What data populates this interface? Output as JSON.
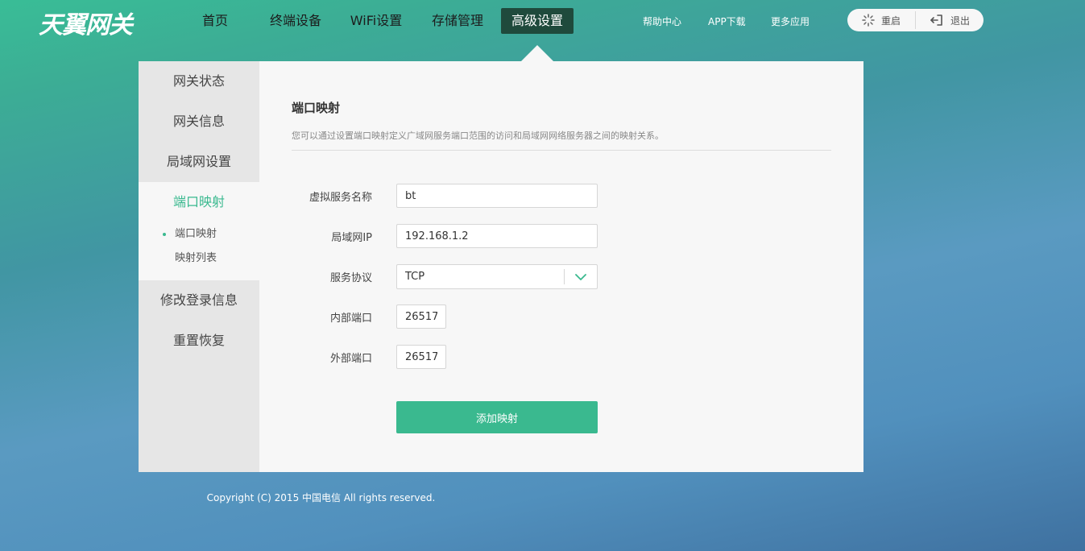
{
  "logo": {
    "text": "天翼网关"
  },
  "nav": {
    "items": [
      "首页",
      "终端设备",
      "WiFi设置",
      "存储管理",
      "高级设置"
    ],
    "active": "高级设置"
  },
  "top_links": [
    "帮助中心",
    "APP下载",
    "更多应用"
  ],
  "actions": {
    "reboot_label": "重启",
    "logout_label": "退出"
  },
  "sidebar": {
    "items": [
      "网关状态",
      "网关信息",
      "局域网设置",
      "端口映射",
      "修改登录信息",
      "重置恢复"
    ],
    "active": "端口映射",
    "subitems": [
      "端口映射",
      "映射列表"
    ],
    "active_sub": "端口映射"
  },
  "page": {
    "title": "端口映射",
    "description": "您可以通过设置端口映射定义广域网服务端口范围的访问和局域网网络服务器之间的映射关系。"
  },
  "form": {
    "service_name_label": "虚拟服务名称",
    "service_name_value": "bt",
    "lan_ip_label": "局域网IP",
    "lan_ip_value": "192.168.1.2",
    "protocol_label": "服务协议",
    "protocol_value": "TCP",
    "internal_port_label": "内部端口",
    "internal_port_value": "26517",
    "external_port_label": "外部端口",
    "external_port_value": "26517",
    "submit_label": "添加映射"
  },
  "footer": {
    "copyright": "Copyright (C) 2015 中国电信 All rights reserved."
  },
  "colors": {
    "accent": "#3ab98f",
    "nav_active_bg": "#1f4a3c",
    "sidebar_bg": "#e6e6e6",
    "panel_bg": "#f7f7f7"
  }
}
